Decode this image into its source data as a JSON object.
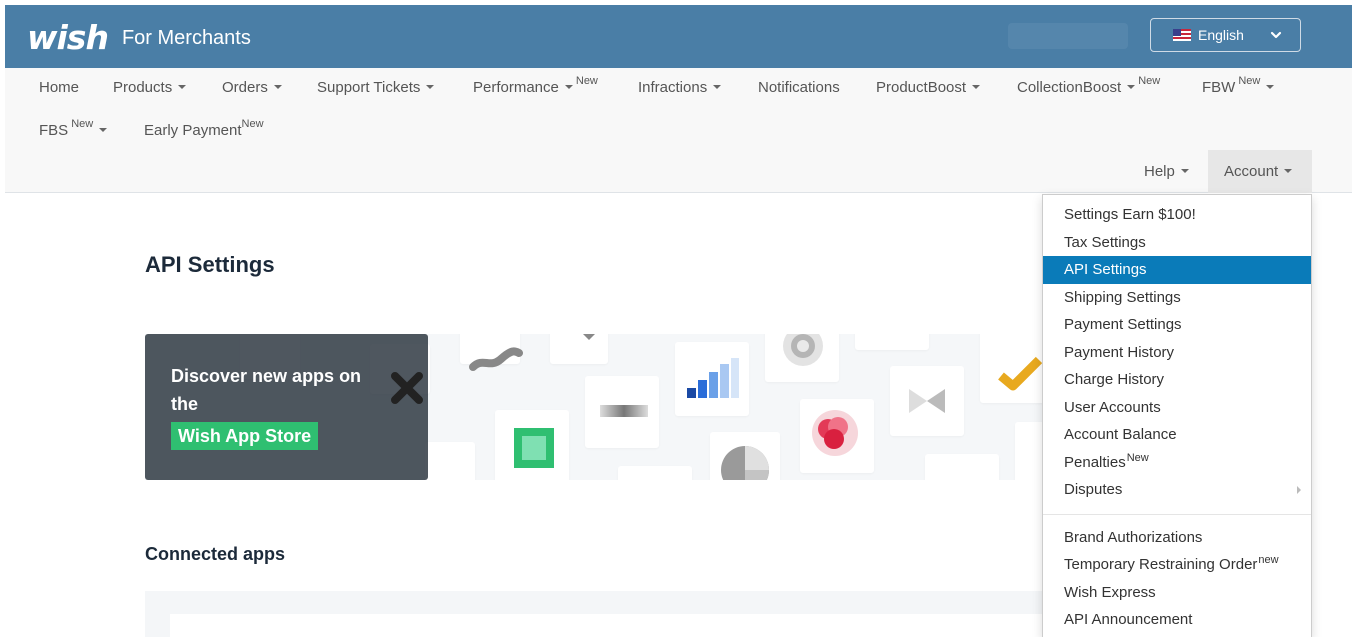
{
  "header": {
    "logo_text": "wish",
    "subtitle": "For Merchants",
    "language": {
      "label": "English",
      "flag": "us-flag-icon"
    }
  },
  "nav": {
    "items": [
      {
        "label": "Home",
        "caret": false,
        "badge": ""
      },
      {
        "label": "Products",
        "caret": true,
        "badge": ""
      },
      {
        "label": "Orders",
        "caret": true,
        "badge": ""
      },
      {
        "label": "Support Tickets",
        "caret": true,
        "badge": ""
      },
      {
        "label": "Performance",
        "caret": true,
        "badge": "New"
      },
      {
        "label": "Infractions",
        "caret": true,
        "badge": ""
      },
      {
        "label": "Notifications",
        "caret": false,
        "badge": ""
      },
      {
        "label": "ProductBoost",
        "caret": true,
        "badge": ""
      },
      {
        "label": "CollectionBoost",
        "caret": true,
        "badge": "New"
      },
      {
        "label": "FBW",
        "caret": true,
        "badge": "New"
      },
      {
        "label": "FBS",
        "caret": true,
        "badge": "New"
      },
      {
        "label": "Early Payment",
        "caret": false,
        "badge": "New"
      }
    ],
    "help": "Help",
    "account": "Account"
  },
  "main": {
    "title": "API Settings",
    "banner": {
      "line1": "Discover new apps on",
      "line2": "the",
      "button": "Wish App Store"
    },
    "connected_apps_title": "Connected apps"
  },
  "account_menu": {
    "items": [
      {
        "label": "Settings Earn $100!",
        "sup": ""
      },
      {
        "label": "Tax Settings",
        "sup": ""
      },
      {
        "label": "API Settings",
        "sup": ""
      },
      {
        "label": "Shipping Settings",
        "sup": ""
      },
      {
        "label": "Payment Settings",
        "sup": ""
      },
      {
        "label": "Payment History",
        "sup": ""
      },
      {
        "label": "Charge History",
        "sup": ""
      },
      {
        "label": "User Accounts",
        "sup": ""
      },
      {
        "label": "Account Balance",
        "sup": ""
      },
      {
        "label": "Penalties",
        "sup": "New"
      },
      {
        "label": "Disputes",
        "sup": ""
      }
    ],
    "items2": [
      {
        "label": "Brand Authorizations",
        "sup": ""
      },
      {
        "label": "Temporary Restraining Order",
        "sup": "new"
      },
      {
        "label": "Wish Express",
        "sup": ""
      },
      {
        "label": "API Announcement",
        "sup": ""
      }
    ],
    "active": "API Settings",
    "active_color": "#0a7bb9"
  },
  "colors": {
    "header_bg": "#4a7ea6",
    "app_store_green": "#2fbf71"
  }
}
